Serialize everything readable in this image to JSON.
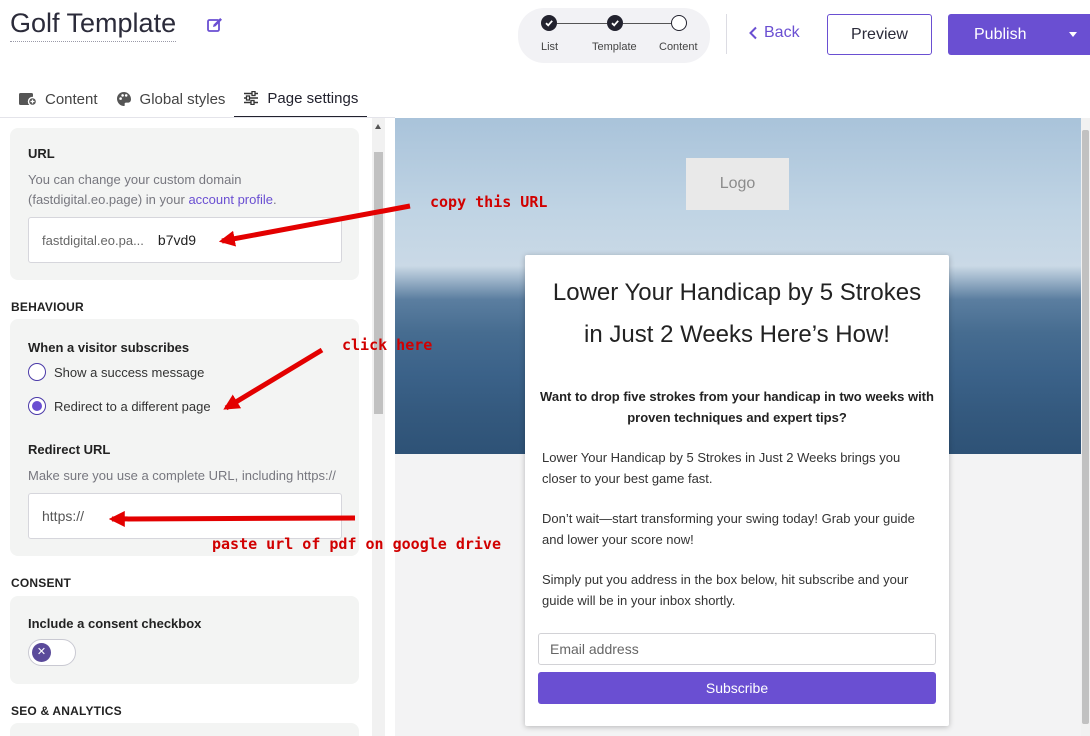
{
  "header": {
    "title": "Golf Template",
    "steps": [
      {
        "label": "List",
        "state": "done"
      },
      {
        "label": "Template",
        "state": "done"
      },
      {
        "label": "Content",
        "state": "current"
      }
    ],
    "back_label": "Back",
    "preview_label": "Preview",
    "publish_label": "Publish"
  },
  "tabs": [
    {
      "label": "Content",
      "icon": "content-icon"
    },
    {
      "label": "Global styles",
      "icon": "palette-icon"
    },
    {
      "label": "Page settings",
      "icon": "sliders-icon",
      "active": true
    }
  ],
  "url_section": {
    "title": "URL",
    "help_prefix": "You can change your custom domain (fastdigital.eo.page) in your ",
    "help_link": "account profile",
    "help_suffix": ".",
    "url_prefix": "fastdigital.eo.pa...",
    "url_slug": "b7vd9"
  },
  "behaviour": {
    "label": "BEHAVIOUR",
    "title": "When a visitor subscribes",
    "options": [
      {
        "label": "Show a success message",
        "checked": false
      },
      {
        "label": "Redirect to a different page",
        "checked": true
      }
    ],
    "redirect_title": "Redirect URL",
    "redirect_help": "Make sure you use a complete URL, including https://",
    "redirect_value": "https://"
  },
  "consent": {
    "label": "CONSENT",
    "title": "Include a consent checkbox",
    "enabled": false
  },
  "seo": {
    "label": "SEO & ANALYTICS"
  },
  "preview": {
    "logo": "Logo",
    "headline_line1": "Lower Your Handicap by 5 Strokes",
    "headline_line2": "in Just 2 Weeks Here’s How!",
    "subheadline": "Want to drop five strokes from your handicap in two weeks with proven techniques and expert tips?",
    "paragraphs": [
      "Lower Your Handicap by 5 Strokes in Just 2 Weeks brings you closer to your best game fast.",
      "Don’t wait—start transforming your swing today! Grab your guide and lower your score now!",
      "Simply put you address in the box below, hit subscribe and your guide will be in your inbox shortly."
    ],
    "email_placeholder": "Email address",
    "subscribe_label": "Subscribe"
  },
  "annotations": {
    "copy_url": "copy this URL",
    "click_here": "click here",
    "paste_url": "paste url of pdf on google drive"
  },
  "colors": {
    "accent": "#6a4fd2",
    "annotation": "#d10000"
  }
}
